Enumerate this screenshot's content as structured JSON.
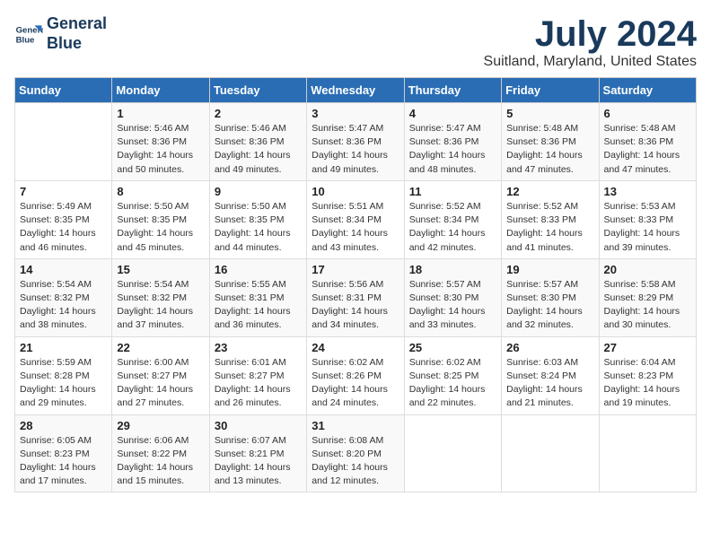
{
  "header": {
    "logo_line1": "General",
    "logo_line2": "Blue",
    "month_year": "July 2024",
    "location": "Suitland, Maryland, United States"
  },
  "days_of_week": [
    "Sunday",
    "Monday",
    "Tuesday",
    "Wednesday",
    "Thursday",
    "Friday",
    "Saturday"
  ],
  "weeks": [
    [
      {
        "day": "",
        "content": ""
      },
      {
        "day": "1",
        "content": "Sunrise: 5:46 AM\nSunset: 8:36 PM\nDaylight: 14 hours\nand 50 minutes."
      },
      {
        "day": "2",
        "content": "Sunrise: 5:46 AM\nSunset: 8:36 PM\nDaylight: 14 hours\nand 49 minutes."
      },
      {
        "day": "3",
        "content": "Sunrise: 5:47 AM\nSunset: 8:36 PM\nDaylight: 14 hours\nand 49 minutes."
      },
      {
        "day": "4",
        "content": "Sunrise: 5:47 AM\nSunset: 8:36 PM\nDaylight: 14 hours\nand 48 minutes."
      },
      {
        "day": "5",
        "content": "Sunrise: 5:48 AM\nSunset: 8:36 PM\nDaylight: 14 hours\nand 47 minutes."
      },
      {
        "day": "6",
        "content": "Sunrise: 5:48 AM\nSunset: 8:36 PM\nDaylight: 14 hours\nand 47 minutes."
      }
    ],
    [
      {
        "day": "7",
        "content": "Sunrise: 5:49 AM\nSunset: 8:35 PM\nDaylight: 14 hours\nand 46 minutes."
      },
      {
        "day": "8",
        "content": "Sunrise: 5:50 AM\nSunset: 8:35 PM\nDaylight: 14 hours\nand 45 minutes."
      },
      {
        "day": "9",
        "content": "Sunrise: 5:50 AM\nSunset: 8:35 PM\nDaylight: 14 hours\nand 44 minutes."
      },
      {
        "day": "10",
        "content": "Sunrise: 5:51 AM\nSunset: 8:34 PM\nDaylight: 14 hours\nand 43 minutes."
      },
      {
        "day": "11",
        "content": "Sunrise: 5:52 AM\nSunset: 8:34 PM\nDaylight: 14 hours\nand 42 minutes."
      },
      {
        "day": "12",
        "content": "Sunrise: 5:52 AM\nSunset: 8:33 PM\nDaylight: 14 hours\nand 41 minutes."
      },
      {
        "day": "13",
        "content": "Sunrise: 5:53 AM\nSunset: 8:33 PM\nDaylight: 14 hours\nand 39 minutes."
      }
    ],
    [
      {
        "day": "14",
        "content": "Sunrise: 5:54 AM\nSunset: 8:32 PM\nDaylight: 14 hours\nand 38 minutes."
      },
      {
        "day": "15",
        "content": "Sunrise: 5:54 AM\nSunset: 8:32 PM\nDaylight: 14 hours\nand 37 minutes."
      },
      {
        "day": "16",
        "content": "Sunrise: 5:55 AM\nSunset: 8:31 PM\nDaylight: 14 hours\nand 36 minutes."
      },
      {
        "day": "17",
        "content": "Sunrise: 5:56 AM\nSunset: 8:31 PM\nDaylight: 14 hours\nand 34 minutes."
      },
      {
        "day": "18",
        "content": "Sunrise: 5:57 AM\nSunset: 8:30 PM\nDaylight: 14 hours\nand 33 minutes."
      },
      {
        "day": "19",
        "content": "Sunrise: 5:57 AM\nSunset: 8:30 PM\nDaylight: 14 hours\nand 32 minutes."
      },
      {
        "day": "20",
        "content": "Sunrise: 5:58 AM\nSunset: 8:29 PM\nDaylight: 14 hours\nand 30 minutes."
      }
    ],
    [
      {
        "day": "21",
        "content": "Sunrise: 5:59 AM\nSunset: 8:28 PM\nDaylight: 14 hours\nand 29 minutes."
      },
      {
        "day": "22",
        "content": "Sunrise: 6:00 AM\nSunset: 8:27 PM\nDaylight: 14 hours\nand 27 minutes."
      },
      {
        "day": "23",
        "content": "Sunrise: 6:01 AM\nSunset: 8:27 PM\nDaylight: 14 hours\nand 26 minutes."
      },
      {
        "day": "24",
        "content": "Sunrise: 6:02 AM\nSunset: 8:26 PM\nDaylight: 14 hours\nand 24 minutes."
      },
      {
        "day": "25",
        "content": "Sunrise: 6:02 AM\nSunset: 8:25 PM\nDaylight: 14 hours\nand 22 minutes."
      },
      {
        "day": "26",
        "content": "Sunrise: 6:03 AM\nSunset: 8:24 PM\nDaylight: 14 hours\nand 21 minutes."
      },
      {
        "day": "27",
        "content": "Sunrise: 6:04 AM\nSunset: 8:23 PM\nDaylight: 14 hours\nand 19 minutes."
      }
    ],
    [
      {
        "day": "28",
        "content": "Sunrise: 6:05 AM\nSunset: 8:23 PM\nDaylight: 14 hours\nand 17 minutes."
      },
      {
        "day": "29",
        "content": "Sunrise: 6:06 AM\nSunset: 8:22 PM\nDaylight: 14 hours\nand 15 minutes."
      },
      {
        "day": "30",
        "content": "Sunrise: 6:07 AM\nSunset: 8:21 PM\nDaylight: 14 hours\nand 13 minutes."
      },
      {
        "day": "31",
        "content": "Sunrise: 6:08 AM\nSunset: 8:20 PM\nDaylight: 14 hours\nand 12 minutes."
      },
      {
        "day": "",
        "content": ""
      },
      {
        "day": "",
        "content": ""
      },
      {
        "day": "",
        "content": ""
      }
    ]
  ]
}
